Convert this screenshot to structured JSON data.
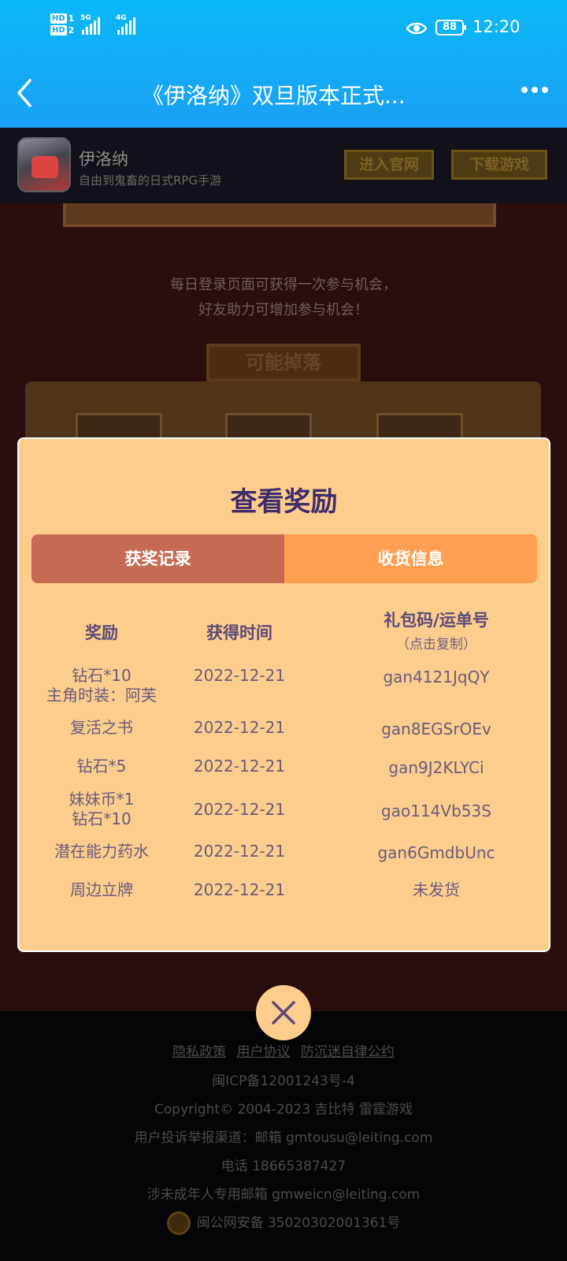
{
  "status_bar": {
    "sim1_label": "HD",
    "sim1_num": "1",
    "sim2_label": "HD",
    "sim2_num": "2",
    "signal1_tag": "5G",
    "signal2_tag": "4G",
    "battery": "88",
    "time": "12:20"
  },
  "header": {
    "title": "《伊洛纳》双旦版本正式..."
  },
  "game_banner": {
    "name": "伊洛纳",
    "subtitle": "自由到鬼畜的日式RPG手游",
    "official_site_label": "进入官网",
    "download_label": "下载游戏"
  },
  "page": {
    "tip_line1": "每日登录页面可获得一次参与机会，",
    "tip_line2": "好友助力可增加参与机会！",
    "drops_title": "可能掉落"
  },
  "modal": {
    "title": "查看奖励",
    "tabs": [
      {
        "label": "获奖记录",
        "active": true
      },
      {
        "label": "收货信息",
        "active": false
      }
    ],
    "columns": {
      "reward": "奖励",
      "time": "获得时间",
      "code": "礼包码/运单号",
      "code_hint": "（点击复制）"
    },
    "rows": [
      {
        "reward_line1": "钻石*10",
        "reward_line2": "主角时装：阿芙",
        "time": "2022-12-21",
        "code": "gan4121JqQY"
      },
      {
        "reward_line1": "复活之书",
        "reward_line2": "",
        "time": "2022-12-21",
        "code": "gan8EGSrOEv"
      },
      {
        "reward_line1": "钻石*5",
        "reward_line2": "",
        "time": "2022-12-21",
        "code": "gan9J2KLYCi"
      },
      {
        "reward_line1": "妹妹币*1",
        "reward_line2": "钻石*10",
        "time": "2022-12-21",
        "code": "gao114Vb53S"
      },
      {
        "reward_line1": "潜在能力药水",
        "reward_line2": "",
        "time": "2022-12-21",
        "code": "gan6GmdbUnc"
      },
      {
        "reward_line1": "周边立牌",
        "reward_line2": "",
        "time": "2022-12-21",
        "code": "未发货"
      }
    ]
  },
  "footer": {
    "links": [
      "隐私政策",
      "用户协议",
      "防沉迷自律公约"
    ],
    "icp": "闽ICP备12001243号-4",
    "copyright": "Copyright© 2004-2023  吉比特  雷霆游戏",
    "complaint": "用户投诉举报渠道：邮箱 gmtousu@leiting.com",
    "phone": "电话 18665387427",
    "minor_email": "涉未成年人专用邮箱 gmweicn@leiting.com",
    "police": "闽公网安备 35020302001361号"
  },
  "colors": {
    "header_blue": "#1aa0f5",
    "modal_bg": "#fdcd8d",
    "tab_active": "#c56b54",
    "tab_inactive": "#ff9f52",
    "title_purple": "#3e2c6b"
  }
}
